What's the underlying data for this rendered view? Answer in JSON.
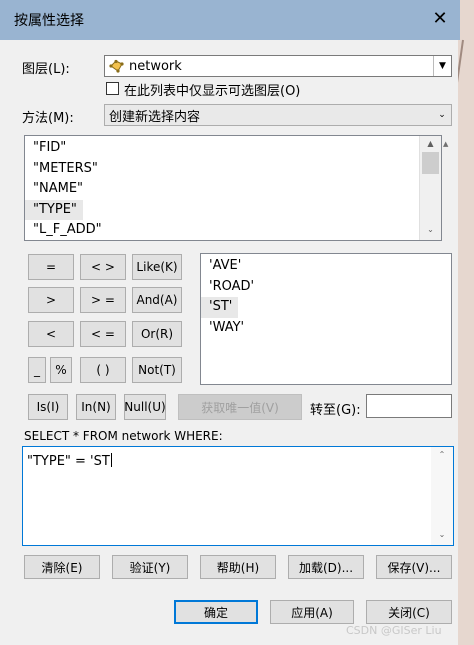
{
  "window": {
    "title": "按属性选择",
    "close_glyph": "✕"
  },
  "layer": {
    "label": "图层(L):",
    "value": "network",
    "checkbox_label": "在此列表中仅显示可选图层(O)",
    "checkbox_checked": false
  },
  "method": {
    "label": "方法(M):",
    "value": "创建新选择内容"
  },
  "fields": {
    "items": [
      "\"FID\"",
      "\"METERS\"",
      "\"NAME\"",
      "\"TYPE\"",
      "\"L_F_ADD\""
    ],
    "selected_index": 3
  },
  "operators": {
    "eq": "=",
    "ne": "< >",
    "like": "Like(K)",
    "gt": ">",
    "ge": "> =",
    "and": "And(A)",
    "lt": "<",
    "le": "< =",
    "or": "Or(R)",
    "underscore": "_",
    "percent": "%",
    "paren": "( )",
    "not": "Not(T)",
    "is": "Is(I)",
    "in": "In(N)",
    "null": "Null(U)"
  },
  "values": {
    "items": [
      "'AVE'",
      "'ROAD'",
      "'ST'",
      "'WAY'"
    ],
    "selected_index": 2
  },
  "unique": {
    "button": "获取唯一值(V)",
    "goto_label": "转至(G):",
    "goto_value": ""
  },
  "query": {
    "prefix": "SELECT * FROM network WHERE:",
    "expression": "\"TYPE\" = 'ST"
  },
  "actions": {
    "clear": "清除(E)",
    "verify": "验证(Y)",
    "help": "帮助(H)",
    "load": "加载(D)...",
    "save": "保存(V)..."
  },
  "footer": {
    "ok": "确定",
    "apply": "应用(A)",
    "close": "关闭(C)"
  },
  "watermark": "CSDN @GISer Liu",
  "colors": {
    "titlebar": "#99b4d1",
    "focus": "#0078d7",
    "dialog_bg": "#f0f0f0"
  }
}
